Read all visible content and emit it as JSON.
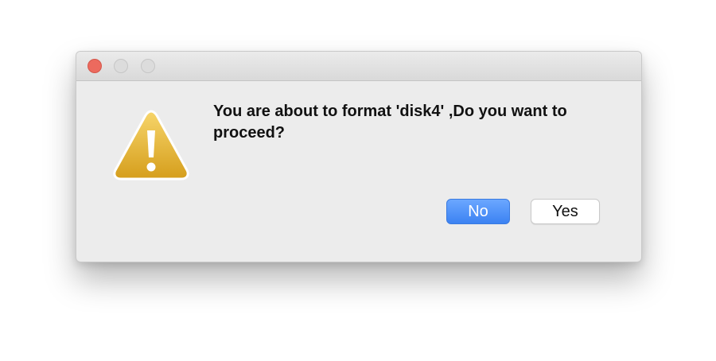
{
  "dialog": {
    "window_controls": [
      {
        "name": "close",
        "color": "#ec6a5e"
      },
      {
        "name": "minimize",
        "color": "#dcdcdc"
      },
      {
        "name": "zoom",
        "color": "#dcdcdc"
      }
    ],
    "icon": "warning-triangle-icon",
    "icon_color": "#e8b832",
    "message": "You are about to format 'disk4' ,Do you want to proceed?",
    "buttons": {
      "no_label": "No",
      "yes_label": "Yes"
    },
    "default_button_color": "#3c82f2"
  }
}
